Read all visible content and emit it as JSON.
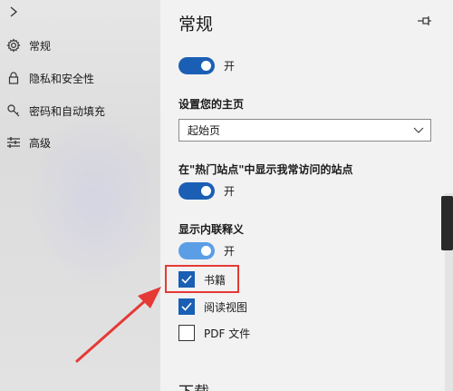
{
  "sidebar": {
    "items": [
      {
        "label": "常规",
        "icon": "gear-icon"
      },
      {
        "label": "隐私和安全性",
        "icon": "lock-icon"
      },
      {
        "label": "密码和自动填充",
        "icon": "key-icon"
      },
      {
        "label": "高级",
        "icon": "sliders-icon"
      }
    ]
  },
  "main": {
    "title": "常规",
    "top_toggle": {
      "label": "开",
      "state": "on"
    },
    "homepage": {
      "heading": "设置您的主页",
      "selected": "起始页"
    },
    "top_sites": {
      "heading": "在\"热门站点\"中显示我常访问的站点",
      "toggle_label": "开",
      "state": "on"
    },
    "inline_definitions": {
      "heading": "显示内联释义",
      "toggle_label": "开",
      "state": "on",
      "options": [
        {
          "label": "书籍",
          "checked": true
        },
        {
          "label": "阅读视图",
          "checked": true
        },
        {
          "label": "PDF 文件",
          "checked": false
        }
      ]
    },
    "downloads_heading": "下载"
  },
  "colors": {
    "accent": "#1a5fb4",
    "toggle_light": "#5b9ee6",
    "annotation_red": "#e53935",
    "sidebar_bg": "#e2e2e2",
    "main_bg": "#f2f2f2"
  }
}
